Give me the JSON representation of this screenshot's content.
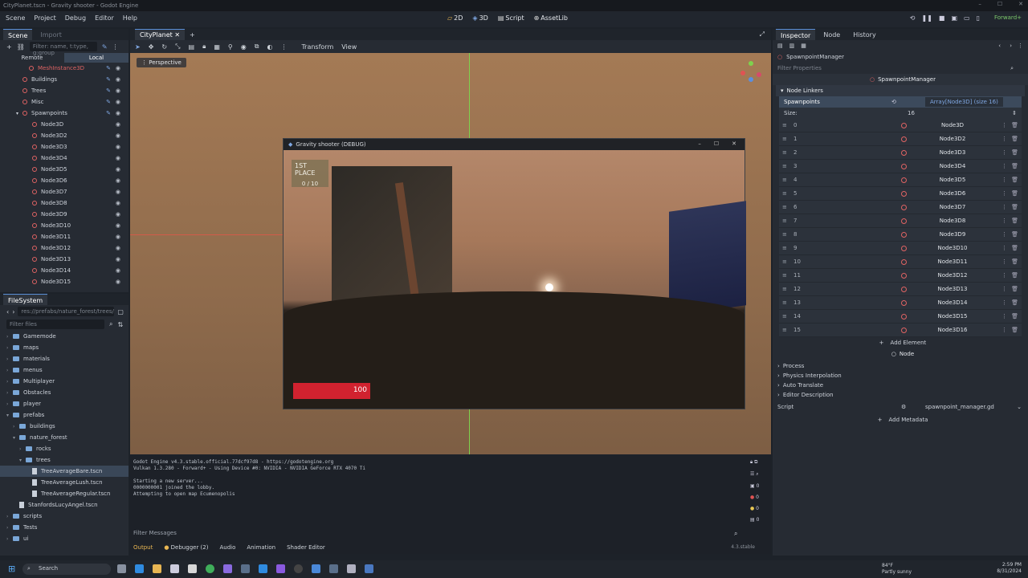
{
  "window": {
    "title": "CityPlanet.tscn - Gravity shooter - Godot Engine"
  },
  "menu": [
    "Scene",
    "Project",
    "Debug",
    "Editor",
    "Help"
  ],
  "workspaces": [
    "2D",
    "3D",
    "Script",
    "AssetLib"
  ],
  "renderer": "Forward+",
  "scene_panel": {
    "tabs": [
      "Scene",
      "Import"
    ],
    "filter_placeholder": "Filter: name, t:type, g:group",
    "remote": "Remote",
    "local": "Local",
    "nodes": [
      "MeshInstance3D",
      "Buildings",
      "Trees",
      "Misc",
      "Spawnpoints",
      "Node3D",
      "Node3D2",
      "Node3D3",
      "Node3D4",
      "Node3D5",
      "Node3D6",
      "Node3D7",
      "Node3D8",
      "Node3D9",
      "Node3D10",
      "Node3D11",
      "Node3D12",
      "Node3D13",
      "Node3D14",
      "Node3D15"
    ]
  },
  "filesystem": {
    "title": "FileSystem",
    "path": "res://prefabs/nature_forest/trees/",
    "filter_placeholder": "Filter files",
    "items": [
      "Gamemode",
      "maps",
      "materials",
      "menus",
      "Multiplayer",
      "Obstacles",
      "player",
      "prefabs",
      "buildings",
      "nature_forest",
      "rocks",
      "trees",
      "TreeAverageBare.tscn",
      "TreeAverageLush.tscn",
      "TreeAverageRegular.tscn",
      "StanfordsLucyAngel.tscn",
      "scripts",
      "Tests",
      "ui"
    ]
  },
  "viewport": {
    "tab": "CityPlanet",
    "transform": "Transform",
    "view": "View",
    "perspective": "Perspective"
  },
  "game_window": {
    "title": "Gravity shooter (DEBUG)",
    "place": "1ST PLACE",
    "score": "0 / 10",
    "health": "100"
  },
  "output": {
    "lines": [
      "Godot Engine v4.3.stable.official.77dcf97d8 - https://godotengine.org",
      "Vulkan 1.3.280 - Forward+ - Using Device #0: NVIDIA - NVIDIA GeForce RTX 4070 Ti",
      "",
      "Starting a new server...",
      "0000000001 joined the lobby.",
      "Attempting to open map Ecumenopolis"
    ],
    "filter_placeholder": "Filter Messages",
    "bottom_tabs": [
      "Output",
      "Debugger (2)",
      "Audio",
      "Animation",
      "Shader Editor"
    ],
    "version": "4.3.stable",
    "counts": [
      "0",
      "0",
      "0",
      "0"
    ]
  },
  "inspector": {
    "tabs": [
      "Inspector",
      "Node",
      "History"
    ],
    "selected": "SpawnpointManager",
    "filter_placeholder": "Filter Properties",
    "node_header": "SpawnpointManager",
    "section": "Node Linkers",
    "spawnpoints_label": "Spawnpoints",
    "array_type": "Array[Node3D] (size 16)",
    "size_label": "Size:",
    "size_value": "16",
    "elements": [
      {
        "idx": "0",
        "node": "Node3D"
      },
      {
        "idx": "1",
        "node": "Node3D2"
      },
      {
        "idx": "2",
        "node": "Node3D3"
      },
      {
        "idx": "3",
        "node": "Node3D4"
      },
      {
        "idx": "4",
        "node": "Node3D5"
      },
      {
        "idx": "5",
        "node": "Node3D6"
      },
      {
        "idx": "6",
        "node": "Node3D7"
      },
      {
        "idx": "7",
        "node": "Node3D8"
      },
      {
        "idx": "8",
        "node": "Node3D9"
      },
      {
        "idx": "9",
        "node": "Node3D10"
      },
      {
        "idx": "10",
        "node": "Node3D11"
      },
      {
        "idx": "11",
        "node": "Node3D12"
      },
      {
        "idx": "12",
        "node": "Node3D13"
      },
      {
        "idx": "13",
        "node": "Node3D14"
      },
      {
        "idx": "14",
        "node": "Node3D15"
      },
      {
        "idx": "15",
        "node": "Node3D16"
      }
    ],
    "add_element": "Add Element",
    "node_section": "Node",
    "categories": [
      "Process",
      "Physics Interpolation",
      "Auto Translate",
      "Editor Description"
    ],
    "script_label": "Script",
    "script_value": "spawnpoint_manager.gd",
    "add_metadata": "Add Metadata"
  },
  "taskbar": {
    "search": "Search",
    "weather_temp": "84°F",
    "weather_desc": "Partly sunny",
    "time": "2:59 PM",
    "date": "8/31/2024"
  }
}
